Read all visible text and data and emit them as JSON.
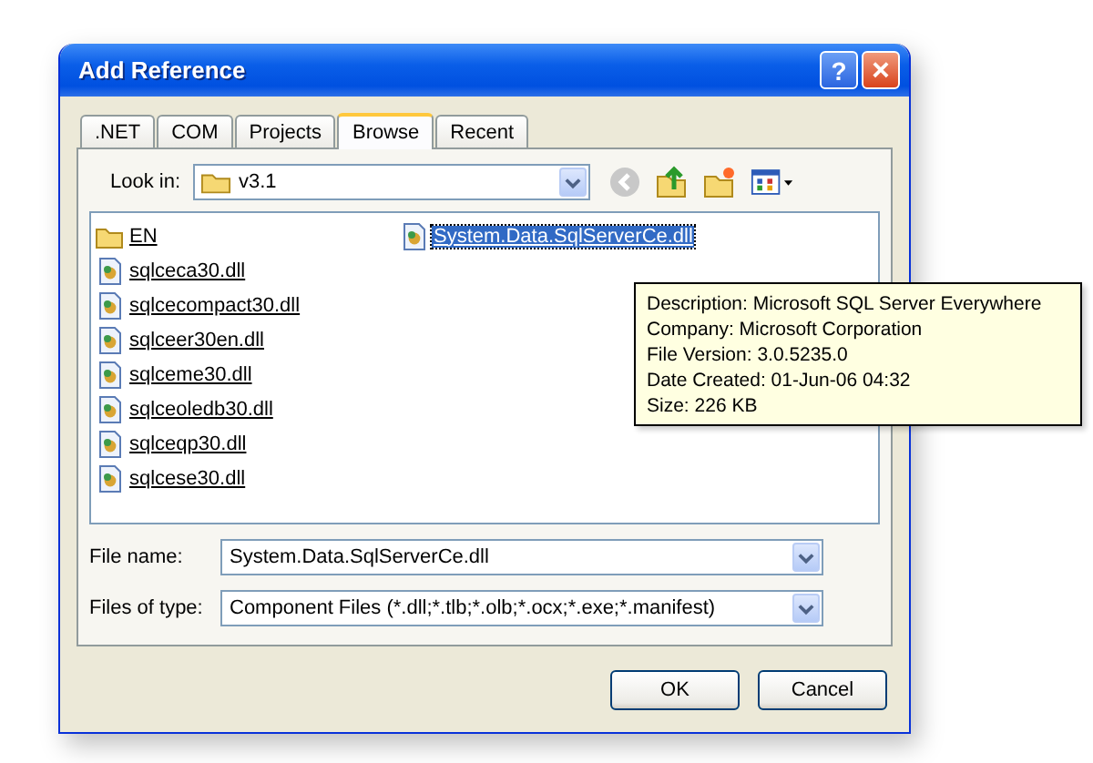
{
  "window": {
    "title": "Add Reference"
  },
  "title_buttons": [
    {
      "kind": "help",
      "label": "?"
    },
    {
      "kind": "close",
      "label": "×"
    }
  ],
  "tabs": [
    {
      "label": ".NET",
      "selected": false
    },
    {
      "label": "COM",
      "selected": false
    },
    {
      "label": "Projects",
      "selected": false
    },
    {
      "label": "Browse",
      "selected": true
    },
    {
      "label": "Recent",
      "selected": false
    }
  ],
  "look_in": {
    "label": "Look in:",
    "value": "v3.1"
  },
  "files": [
    {
      "name": "EN",
      "kind": "folder",
      "selected": false
    },
    {
      "name": "sqlceca30.dll",
      "kind": "dll",
      "selected": false
    },
    {
      "name": "sqlcecompact30.dll",
      "kind": "dll",
      "selected": false
    },
    {
      "name": "sqlceer30en.dll",
      "kind": "dll",
      "selected": false
    },
    {
      "name": "sqlceme30.dll",
      "kind": "dll",
      "selected": false
    },
    {
      "name": "sqlceoledb30.dll",
      "kind": "dll",
      "selected": false
    },
    {
      "name": "sqlceqp30.dll",
      "kind": "dll",
      "selected": false
    },
    {
      "name": "sqlcese30.dll",
      "kind": "dll",
      "selected": false
    },
    {
      "name": "System.Data.SqlServerCe.dll",
      "kind": "dll",
      "selected": true
    }
  ],
  "tooltip": [
    "Description: Microsoft SQL Server Everywhere",
    "Company: Microsoft Corporation",
    "File Version: 3.0.5235.0",
    "Date Created: 01-Jun-06 04:32",
    "Size: 226 KB"
  ],
  "file_name": {
    "label": "File name:",
    "value": "System.Data.SqlServerCe.dll"
  },
  "files_of_type": {
    "label": "Files of type:",
    "value": "Component Files (*.dll;*.tlb;*.olb;*.ocx;*.exe;*.manifest)"
  },
  "buttons": [
    "OK",
    "Cancel"
  ]
}
